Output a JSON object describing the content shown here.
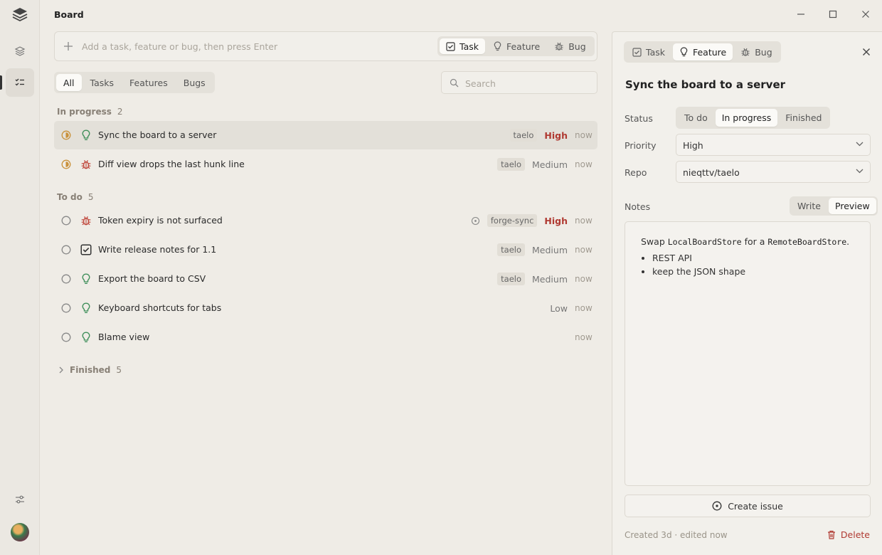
{
  "app": {
    "title": "Board"
  },
  "add_bar": {
    "placeholder": "Add a task, feature or bug, then press Enter",
    "types": [
      {
        "label": "Task",
        "icon": "checkbox-icon",
        "selected": true
      },
      {
        "label": "Feature",
        "icon": "lightbulb-icon",
        "selected": false
      },
      {
        "label": "Bug",
        "icon": "bug-icon",
        "selected": false
      }
    ]
  },
  "filters": [
    {
      "label": "All",
      "selected": true
    },
    {
      "label": "Tasks",
      "selected": false
    },
    {
      "label": "Features",
      "selected": false
    },
    {
      "label": "Bugs",
      "selected": false
    }
  ],
  "search": {
    "placeholder": "Search"
  },
  "groups": {
    "in_progress": {
      "label": "In progress",
      "count": "2",
      "rows": [
        {
          "title": "Sync the board to a server",
          "kind": "feature",
          "repo": "taelo",
          "priority": "High",
          "age": "now",
          "selected": true
        },
        {
          "title": "Diff view drops the last hunk line",
          "kind": "bug",
          "repo": "taelo",
          "priority": "Medium",
          "age": "now",
          "selected": false
        }
      ]
    },
    "todo": {
      "label": "To do",
      "count": "5",
      "rows": [
        {
          "title": "Token expiry is not surfaced",
          "kind": "bug",
          "repo": "forge-sync",
          "priority": "High",
          "age": "now",
          "linked": true
        },
        {
          "title": "Write release notes for 1.1",
          "kind": "task",
          "repo": "taelo",
          "priority": "Medium",
          "age": "now"
        },
        {
          "title": "Export the board to CSV",
          "kind": "feature",
          "repo": "taelo",
          "priority": "Medium",
          "age": "now"
        },
        {
          "title": "Keyboard shortcuts for tabs",
          "kind": "feature",
          "repo": "",
          "priority": "Low",
          "age": "now"
        },
        {
          "title": "Blame view",
          "kind": "feature",
          "repo": "",
          "priority": "",
          "age": "now"
        }
      ]
    },
    "finished": {
      "label": "Finished",
      "count": "5",
      "collapsed": true
    }
  },
  "detail": {
    "types": [
      {
        "label": "Task",
        "selected": false
      },
      {
        "label": "Feature",
        "selected": true
      },
      {
        "label": "Bug",
        "selected": false
      }
    ],
    "title": "Sync the board to a server",
    "status_label": "Status",
    "status_options": [
      {
        "label": "To do",
        "selected": false
      },
      {
        "label": "In progress",
        "selected": true
      },
      {
        "label": "Finished",
        "selected": false
      }
    ],
    "priority_label": "Priority",
    "priority_value": "High",
    "repo_label": "Repo",
    "repo_value": "nieqttv/taelo",
    "notes_label": "Notes",
    "notes_modes": [
      {
        "label": "Write",
        "selected": false
      },
      {
        "label": "Preview",
        "selected": true
      }
    ],
    "notes": {
      "pre": "Swap ",
      "code1": "LocalBoardStore",
      "mid": " for a ",
      "code2": "RemoteBoardStore",
      "post": ".",
      "bullets": [
        "REST API",
        "keep the JSON shape"
      ]
    },
    "create_label": "Create issue",
    "meta": "Created 3d · edited now",
    "delete_label": "Delete"
  },
  "colors": {
    "accent_red": "#b03a32",
    "feature_green": "#3f8f5a",
    "bug_red": "#c0473c",
    "inprogress_amber": "#c9913a"
  }
}
